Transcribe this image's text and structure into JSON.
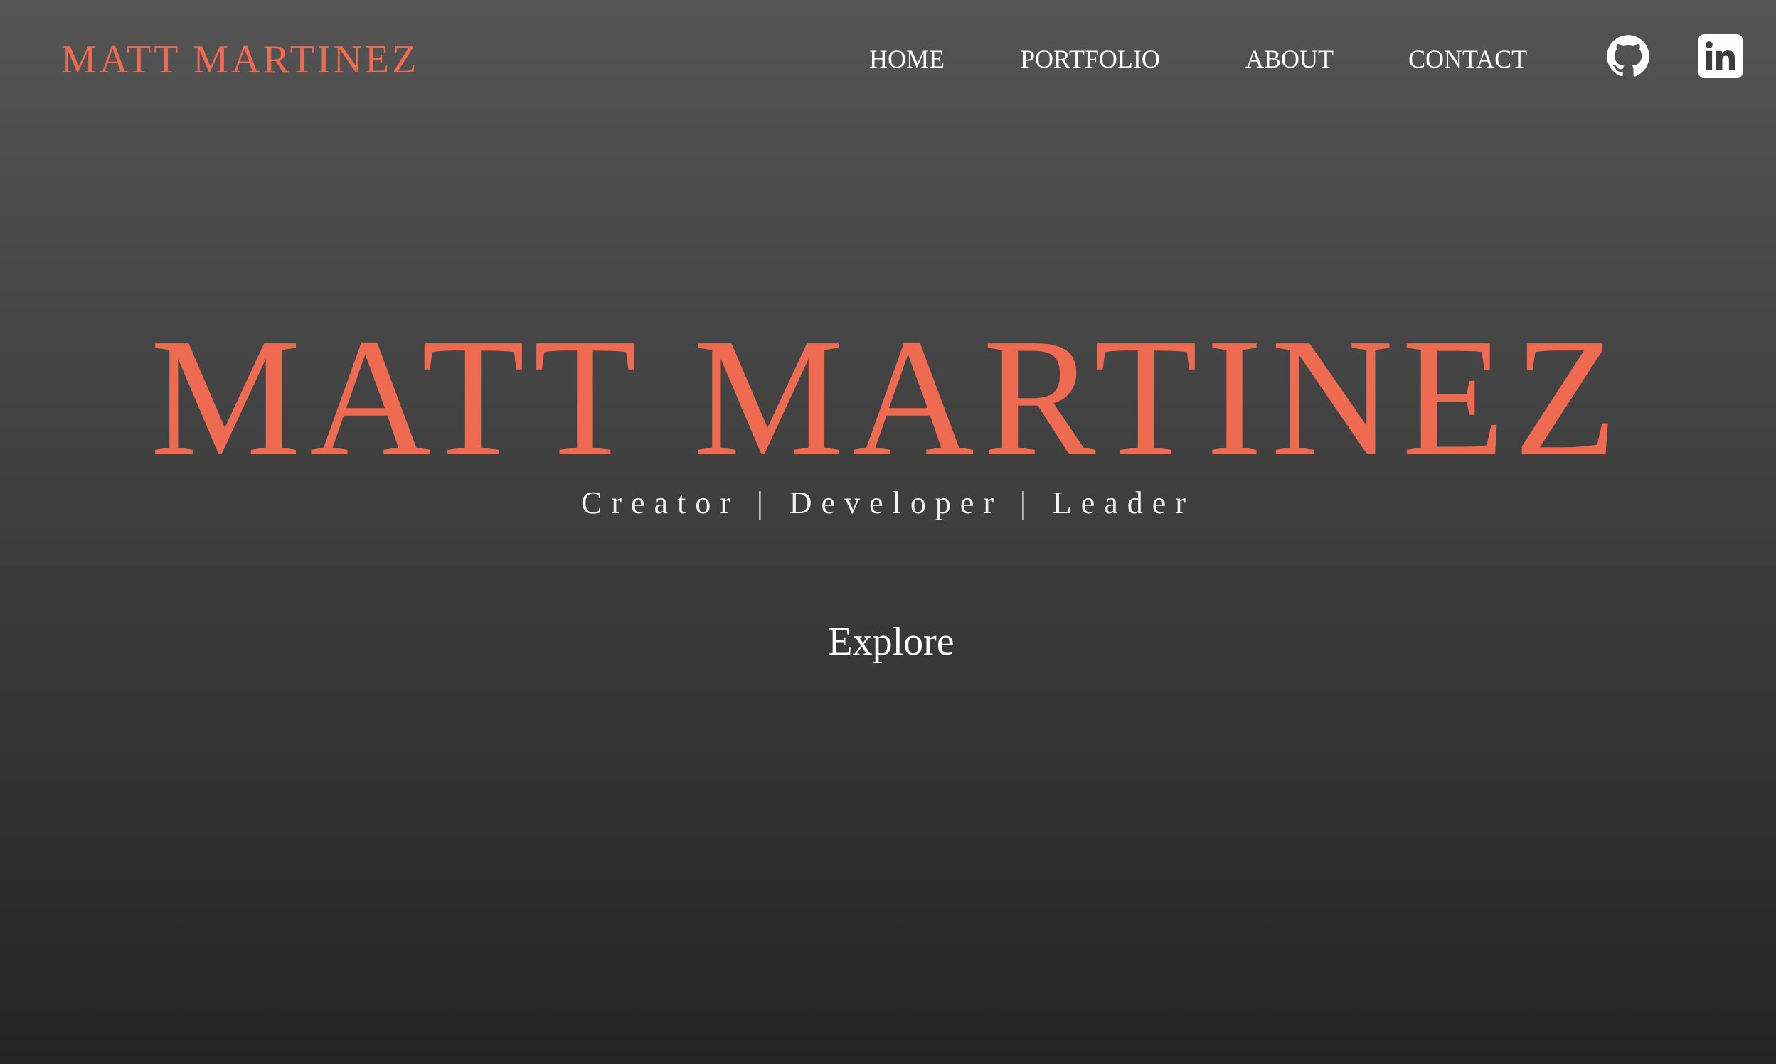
{
  "header": {
    "brand": "MATT MARTINEZ",
    "nav": {
      "home": "HOME",
      "portfolio": "PORTFOLIO",
      "about": "ABOUT",
      "contact": "CONTACT"
    },
    "social": [
      {
        "icon": "github-icon"
      },
      {
        "icon": "linkedin-icon"
      }
    ]
  },
  "hero": {
    "title": "MATT MARTINEZ",
    "tagline": "Creator | Developer | Leader",
    "explore_label": "Explore"
  },
  "colors": {
    "accent": "#ee6a50",
    "text": "#ffffff",
    "background_top": "#545454",
    "background_bottom": "#242424"
  }
}
